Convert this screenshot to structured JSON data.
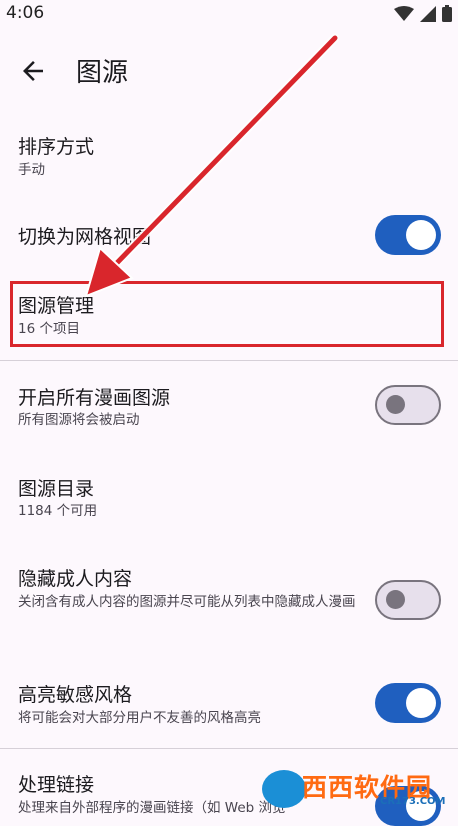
{
  "status_bar": {
    "time": "4:06",
    "icons": [
      "wifi-icon",
      "cellular-icon",
      "battery-icon"
    ]
  },
  "header": {
    "title": "图源",
    "back_icon": "arrow-left-icon"
  },
  "settings": {
    "sort": {
      "title": "排序方式",
      "subtitle": "手动"
    },
    "grid_view": {
      "title": "切换为网格视图",
      "enabled": true
    },
    "source_management": {
      "title": "图源管理",
      "subtitle": "16 个项目"
    },
    "enable_all": {
      "title": "开启所有漫画图源",
      "subtitle": "所有图源将会被启动",
      "enabled": false
    },
    "catalog": {
      "title": "图源目录",
      "subtitle": "1184 个可用"
    },
    "hide_nsfw": {
      "title": "隐藏成人内容",
      "subtitle": "关闭含有成人内容的图源并尽可能从列表中隐藏成人漫画",
      "enabled": false
    },
    "highlight_nsfw": {
      "title": "高亮敏感风格",
      "subtitle": "将可能会对大部分用户不友善的风格高亮",
      "enabled": true
    },
    "handle_links": {
      "title": "处理链接",
      "subtitle": "处理来自外部程序的漫画链接（如 Web 浏览",
      "enabled": true
    }
  },
  "annotation": {
    "color": "#d9262c"
  },
  "watermark": {
    "text": "西西软件园",
    "sub": "CR173.COM"
  },
  "colors": {
    "accent": "#1f5fbf",
    "background": "#fdf8fd"
  }
}
